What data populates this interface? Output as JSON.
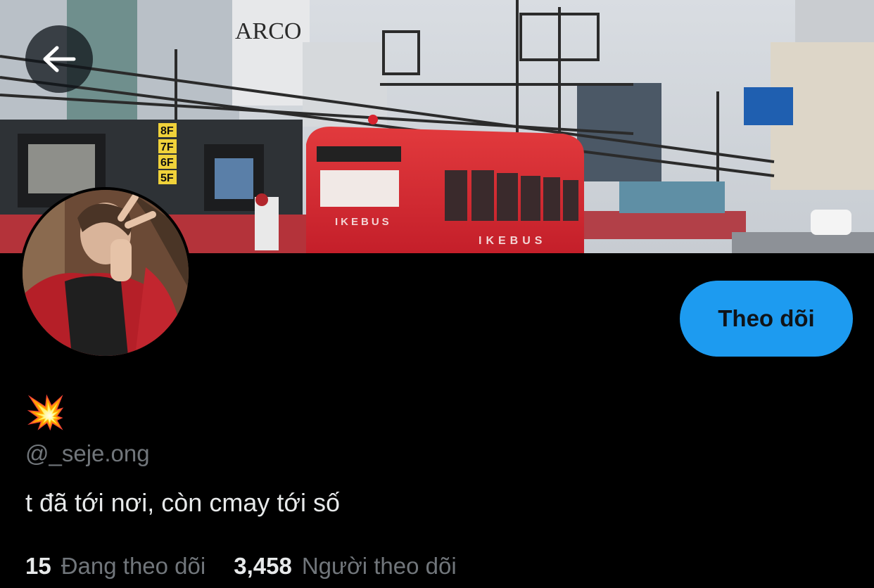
{
  "banner": {
    "sign_arco": "ARCO",
    "bus_name": "IKEBUS",
    "bus_name_side": "IKEBUS",
    "floor_labels": [
      "8F",
      "7F",
      "6F",
      "5F"
    ]
  },
  "header": {
    "back_icon": "arrow-left-icon"
  },
  "profile": {
    "display_name": "💥",
    "handle": "@_seje.ong",
    "bio": "t đã tới nơi, còn cmay tới số",
    "follow_label": "Theo dõi",
    "following_count": "15",
    "following_label": "Đang theo dõi",
    "followers_count": "3,458",
    "followers_label": "Người theo dõi"
  },
  "colors": {
    "accent": "#1d9bf0",
    "background": "#000000",
    "muted": "#71767b",
    "text": "#e7e9ea",
    "bus_red": "#d8232f"
  }
}
